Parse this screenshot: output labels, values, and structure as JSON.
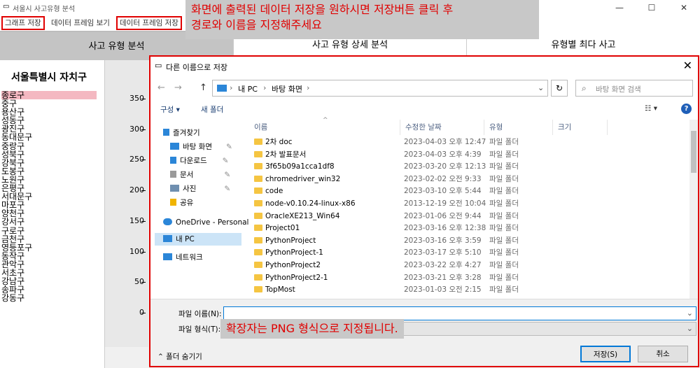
{
  "window": {
    "title": "서울시 사고유형 분석",
    "controls": [
      "—",
      "☐",
      "✕"
    ]
  },
  "menu": [
    "그래프 저장",
    "데이터 프레임 보기",
    "데이터 프레임 저장"
  ],
  "annotation_top": [
    "화면에 출력된 데이터 저장을 원하시면 저장버튼 클릭 후",
    "경로와 이름을 지정해주세요"
  ],
  "tabs": [
    "사고 유형 분석",
    "사고 유형 상세 분석",
    "유형별 최다 사고"
  ],
  "left_panel": {
    "header": "서울특별시 자치구",
    "districts": [
      "종로구",
      "중구",
      "용산구",
      "성동구",
      "광진구",
      "동대문구",
      "중랑구",
      "성북구",
      "강북구",
      "도봉구",
      "노원구",
      "은평구",
      "서대문구",
      "마포구",
      "양천구",
      "강서구",
      "구로구",
      "금천구",
      "영등포구",
      "동작구",
      "관악구",
      "서초구",
      "강남구",
      "송파구",
      "강동구"
    ],
    "selected": "종로구"
  },
  "chart_data": {
    "type": "bar",
    "yticks": [
      350,
      300,
      250,
      200,
      150,
      100,
      50,
      0
    ]
  },
  "dialog": {
    "title": "다른 이름으로 저장",
    "close": "✕",
    "nav": {
      "back": "←",
      "forward": "→",
      "up": "↑"
    },
    "breadcrumb": [
      "내 PC",
      "바탕 화면"
    ],
    "search_placeholder": "바탕 화면 검색",
    "toolbar": {
      "organize": "구성 ▾",
      "new_folder": "새 폴더",
      "view": "☷ ▾",
      "help": "?"
    },
    "nav_items": {
      "quick": "즐겨찾기",
      "desktop": "바탕 화면",
      "downloads": "다운로드",
      "documents": "문서",
      "pictures": "사진",
      "share": "공유",
      "onedrive": "OneDrive - Personal",
      "thispc": "내 PC",
      "network": "네트워크"
    },
    "columns": {
      "name": "이름",
      "modified": "수정한 날짜",
      "type": "유형",
      "size": "크기"
    },
    "files": [
      {
        "name": "2차 doc",
        "date": "2023-04-03 오후 12:47",
        "type": "파일 폴더"
      },
      {
        "name": "2차 발표문서",
        "date": "2023-04-03 오후 4:39",
        "type": "파일 폴더"
      },
      {
        "name": "3f65b09a1cca1df8",
        "date": "2023-03-20 오후 12:13",
        "type": "파일 폴더"
      },
      {
        "name": "chromedriver_win32",
        "date": "2023-02-02 오전 9:33",
        "type": "파일 폴더"
      },
      {
        "name": "code",
        "date": "2023-03-10 오후 5:44",
        "type": "파일 폴더"
      },
      {
        "name": "node-v0.10.24-linux-x86",
        "date": "2013-12-19 오전 10:04",
        "type": "파일 폴더"
      },
      {
        "name": "OracleXE213_Win64",
        "date": "2023-01-06 오전 9:44",
        "type": "파일 폴더"
      },
      {
        "name": "Project01",
        "date": "2023-03-16 오후 12:38",
        "type": "파일 폴더"
      },
      {
        "name": "PythonProject",
        "date": "2023-03-16 오후 3:59",
        "type": "파일 폴더"
      },
      {
        "name": "PythonProject-1",
        "date": "2023-03-17 오후 5:10",
        "type": "파일 폴더"
      },
      {
        "name": "PythonProject2",
        "date": "2023-03-22 오후 4:27",
        "type": "파일 폴더"
      },
      {
        "name": "PythonProject2-1",
        "date": "2023-03-21 오후 3:28",
        "type": "파일 폴더"
      },
      {
        "name": "TopMost",
        "date": "2023-01-03 오전 2:15",
        "type": "파일 폴더"
      }
    ],
    "filename_label": "파일 이름(N):",
    "filename_value": "",
    "filetype_label": "파일 형식(T):",
    "annotation_bottom": "확장자는 PNG 형식으로 지정됩니다.",
    "hide_folders": "폴더 숨기기",
    "save": "저장(S)",
    "cancel": "취소"
  }
}
